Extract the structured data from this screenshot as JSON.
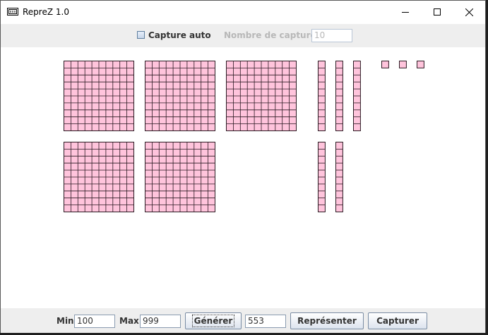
{
  "window": {
    "title": "RepreZ 1.0"
  },
  "topbar": {
    "capture_auto_label": "Capture auto",
    "capture_auto_checked": false,
    "nombre_captures_label": "Nombre de captures",
    "nombre_captures_value": "10"
  },
  "representation": {
    "number": 553,
    "hundreds": 5,
    "tens": 5,
    "units": 3,
    "block_fill": "#ffc4dc",
    "block_stroke": "#2b1a22"
  },
  "bottombar": {
    "min_label": "Min",
    "min_value": "100",
    "max_label": "Max",
    "max_value": "999",
    "generate_label": "Générer",
    "number_value": "553",
    "represent_label": "Représenter",
    "capture_label": "Capturer"
  }
}
